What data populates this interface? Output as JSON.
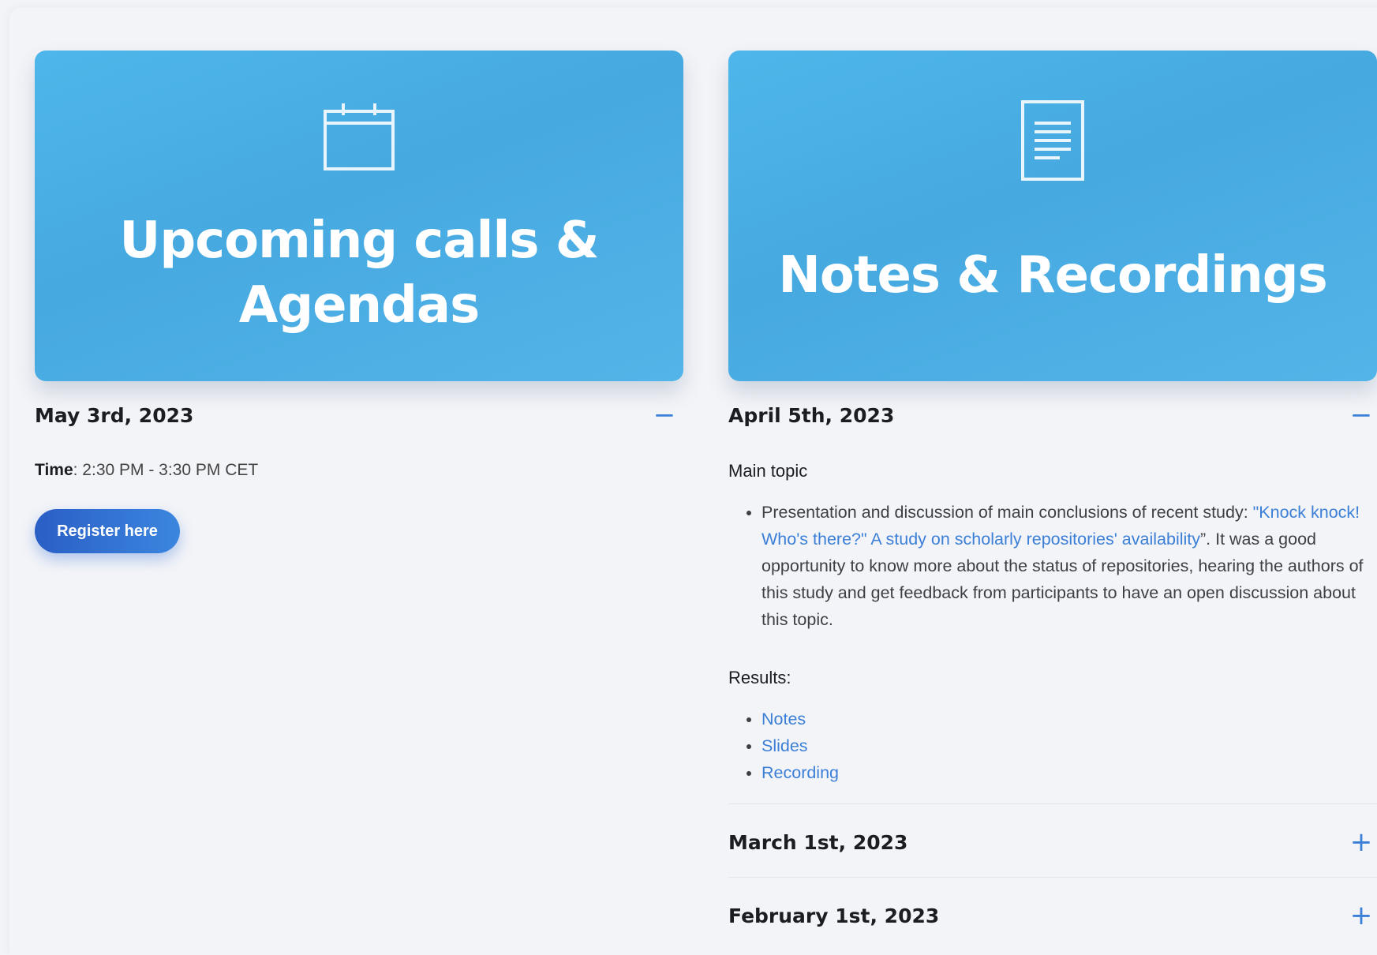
{
  "colors": {
    "accent": "#3b7fd6",
    "hero": "#4eb2e6",
    "button": "#2f6ed0"
  },
  "left": {
    "hero_title_line1": "Upcoming calls &",
    "hero_title_line2": "Agendas",
    "hero_icon": "calendar-icon",
    "item": {
      "date": "May 3rd, 2023",
      "toggle": "−",
      "time_label": "Time",
      "time_value": ": 2:30 PM - 3:30 PM CET",
      "button_label": "Register here"
    }
  },
  "right": {
    "hero_title": "Notes & Recordings",
    "hero_icon": "document-icon",
    "items": [
      {
        "date": "April 5th, 2023",
        "toggle": "−",
        "main_topic_label": "Main topic",
        "bullet_prefix": "Presentation and discussion of main conclusions of recent study: ",
        "bullet_link": "\"Knock knock! Who's there?\" A study on scholarly repositories' availability",
        "bullet_suffix": "”. It was a good opportunity to know more about the status of repositories, hearing the authors of this study and get feedback from participants to have an open discussion about this topic.",
        "results_label": "Results",
        "results_colon": ":",
        "results_links": [
          "Notes",
          "Slides",
          "Recording"
        ]
      },
      {
        "date": "March 1st, 2023",
        "toggle": "+"
      },
      {
        "date": "February 1st, 2023",
        "toggle": "+"
      }
    ]
  }
}
